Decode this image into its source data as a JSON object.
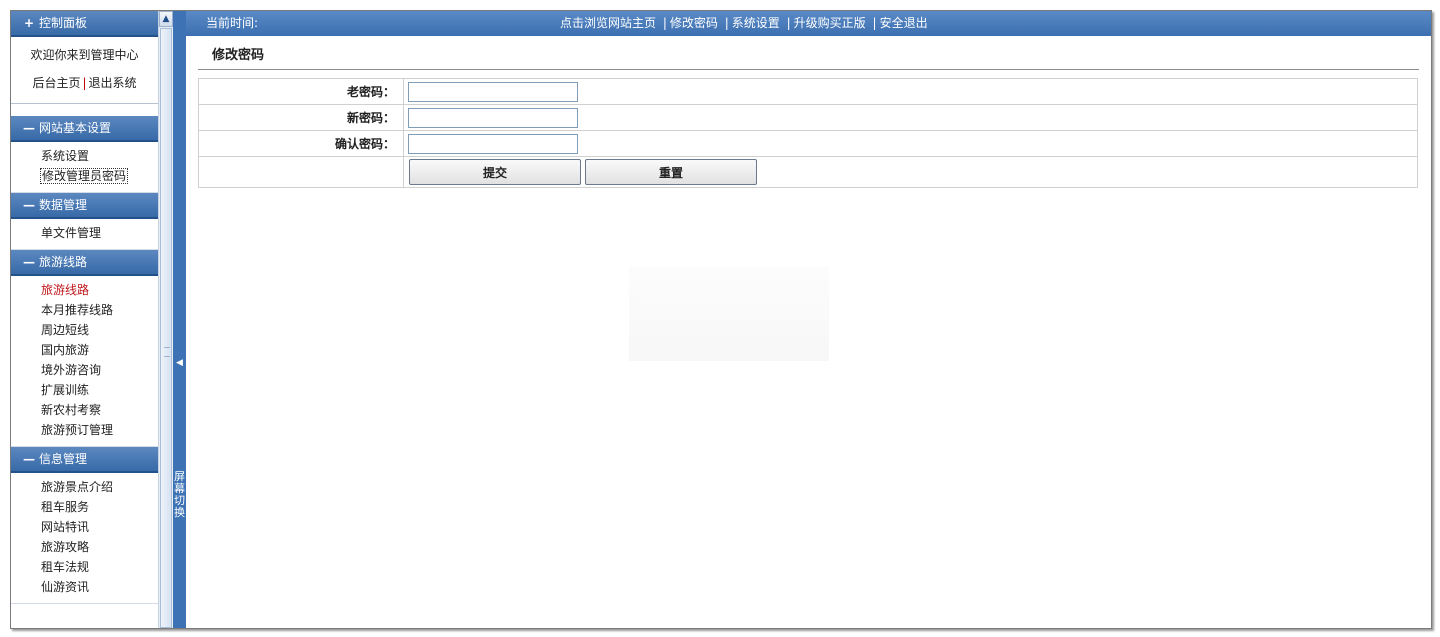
{
  "sidebar": {
    "control_panel": {
      "sign": "+",
      "title": "控制面板"
    },
    "welcome_text": "欢迎你来到管理中心",
    "home_link": "后台主页",
    "sep": "|",
    "logout_link": "退出系统",
    "groups": [
      {
        "sign": "—",
        "title": "网站基本设置",
        "items": [
          "系统设置",
          "修改管理员密码"
        ]
      },
      {
        "sign": "—",
        "title": "数据管理",
        "items": [
          "单文件管理"
        ]
      },
      {
        "sign": "—",
        "title": "旅游线路",
        "items": [
          "旅游线路",
          "本月推荐线路",
          "周边短线",
          "国内旅游",
          "境外游咨询",
          "扩展训练",
          "新农村考察",
          "旅游预订管理"
        ]
      },
      {
        "sign": "—",
        "title": "信息管理",
        "items": [
          "旅游景点介绍",
          "租车服务",
          "网站特讯",
          "旅游攻略",
          "租车法规",
          "仙游资讯"
        ]
      }
    ],
    "active_item": "旅游线路",
    "focused_item": "修改管理员密码"
  },
  "scroll": {
    "up_icon": "▲"
  },
  "toggle": {
    "arrow": "◀",
    "label": "屏幕切换"
  },
  "topbar": {
    "time_label": "当前时间:",
    "links": [
      "点击浏览网站主页",
      "修改密码",
      "系统设置",
      "升级购买正版",
      "安全退出"
    ],
    "pipe": "|"
  },
  "page": {
    "title": "修改密码",
    "old_password_label": "老密码：",
    "old_password_value": "",
    "new_password_label": "新密码：",
    "new_password_value": "",
    "confirm_password_label": "确认密码：",
    "confirm_password_value": "",
    "submit_label": "提交",
    "reset_label": "重置"
  },
  "colors": {
    "header_blue": "#3c6fb0",
    "active_red": "#c0181c"
  }
}
